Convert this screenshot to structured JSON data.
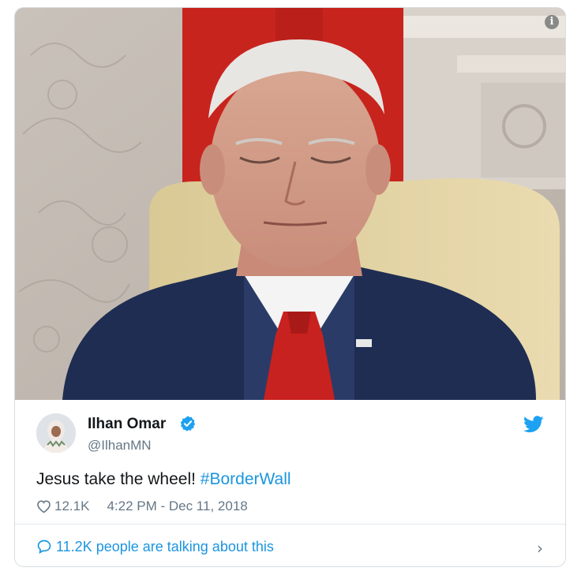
{
  "tweet": {
    "author_name": "Ilhan Omar",
    "handle": "@IlhanMN",
    "text": "Jesus take the wheel! ",
    "hashtag": "#BorderWall",
    "likes": "12.1K",
    "timestamp": "4:22 PM - Dec 11, 2018",
    "verified": true
  },
  "footer": {
    "talking_text": "11.2K people are talking about this",
    "chevron": "›"
  },
  "icons": {
    "info": "info-icon",
    "verified": "verified-badge-icon",
    "brand": "twitter-bird-icon",
    "like": "heart-icon",
    "reply": "speech-bubble-icon"
  },
  "colors": {
    "link": "#1b95e0",
    "secondary_text": "#657786",
    "primary_text": "#14171a",
    "border": "#d9dde1"
  }
}
